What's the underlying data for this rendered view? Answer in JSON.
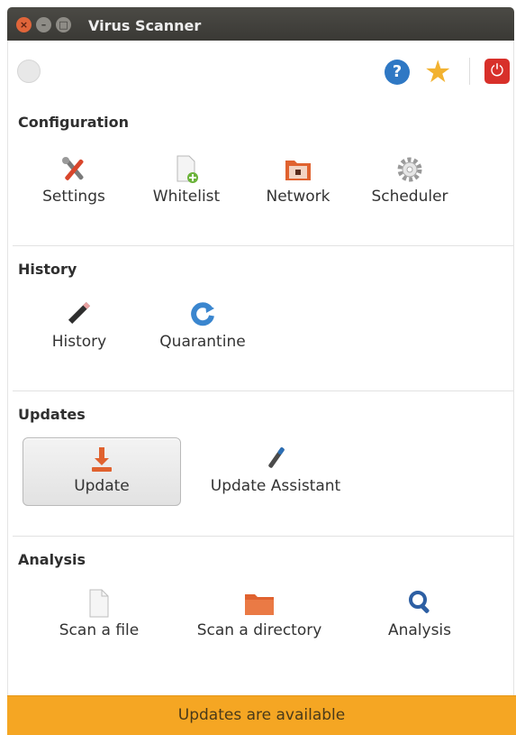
{
  "window": {
    "title": "Virus Scanner"
  },
  "titlebar_buttons": [
    "close",
    "minimize",
    "maximize"
  ],
  "toolbar": {
    "left_icon": "spark-icon",
    "right_icons": [
      "help-icon",
      "star-icon",
      "power-icon"
    ]
  },
  "sections": {
    "configuration": {
      "title": "Configuration",
      "items": [
        {
          "label": "Settings",
          "icon": "tools-icon"
        },
        {
          "label": "Whitelist",
          "icon": "document-add-icon"
        },
        {
          "label": "Network",
          "icon": "network-folder-icon"
        },
        {
          "label": "Scheduler",
          "icon": "gear-icon"
        }
      ]
    },
    "history": {
      "title": "History",
      "items": [
        {
          "label": "History",
          "icon": "pencil-icon"
        },
        {
          "label": "Quarantine",
          "icon": "refresh-icon"
        }
      ]
    },
    "updates": {
      "title": "Updates",
      "items": [
        {
          "label": "Update",
          "icon": "download-icon"
        },
        {
          "label": "Update Assistant",
          "icon": "dropper-icon"
        }
      ]
    },
    "analysis": {
      "title": "Analysis",
      "items": [
        {
          "label": "Scan a file",
          "icon": "file-icon"
        },
        {
          "label": "Scan a directory",
          "icon": "folder-icon"
        },
        {
          "label": "Analysis",
          "icon": "magnifier-icon"
        }
      ]
    }
  },
  "status": {
    "message": "Updates are available"
  },
  "colors": {
    "status_bar": "#f5a623",
    "title_bar": "#3a3935",
    "close_button": "#e0653a"
  }
}
